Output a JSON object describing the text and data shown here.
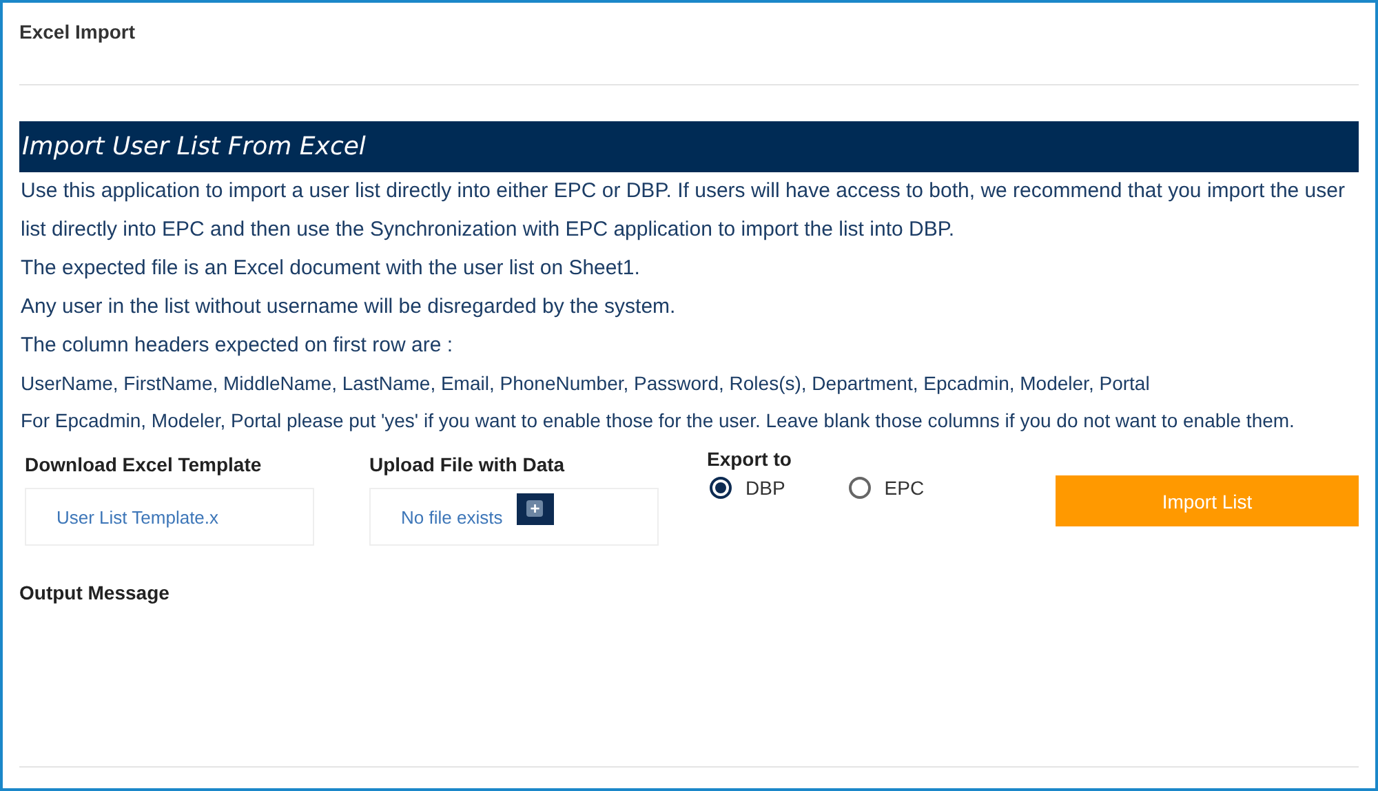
{
  "page_title": "Excel Import",
  "banner": "Import User List From Excel",
  "instructions": [
    {
      "kind": "normal",
      "text": "Use this application to import a user list directly into either EPC or DBP. If users will have access to both, we recommend that you import the user list directly into EPC and then use the Synchronization with EPC application to import the list into DBP."
    },
    {
      "kind": "normal",
      "text": "The expected file is an Excel document with the user list on Sheet1."
    },
    {
      "kind": "normal",
      "text": "Any user in the list without username will be disregarded by the system."
    },
    {
      "kind": "normal",
      "text": "The column headers expected on first row are :"
    },
    {
      "kind": "small",
      "text": "UserName, FirstName, MiddleName, LastName, Email, PhoneNumber, Password, Roles(s), Department, Epcadmin, Modeler, Portal"
    },
    {
      "kind": "small",
      "text": "For Epcadmin, Modeler, Portal please put 'yes' if you want to enable those for the user. Leave blank those columns if you do not want to enable them."
    }
  ],
  "download": {
    "label": "Download Excel Template",
    "link": "User List Template.x"
  },
  "upload": {
    "label": "Upload File with Data",
    "status": "No file exists",
    "button": "+"
  },
  "export": {
    "label": "Export to",
    "options": [
      {
        "label": "DBP",
        "selected": true
      },
      {
        "label": "EPC",
        "selected": false
      }
    ]
  },
  "import_button": "Import List",
  "output_label": "Output Message"
}
